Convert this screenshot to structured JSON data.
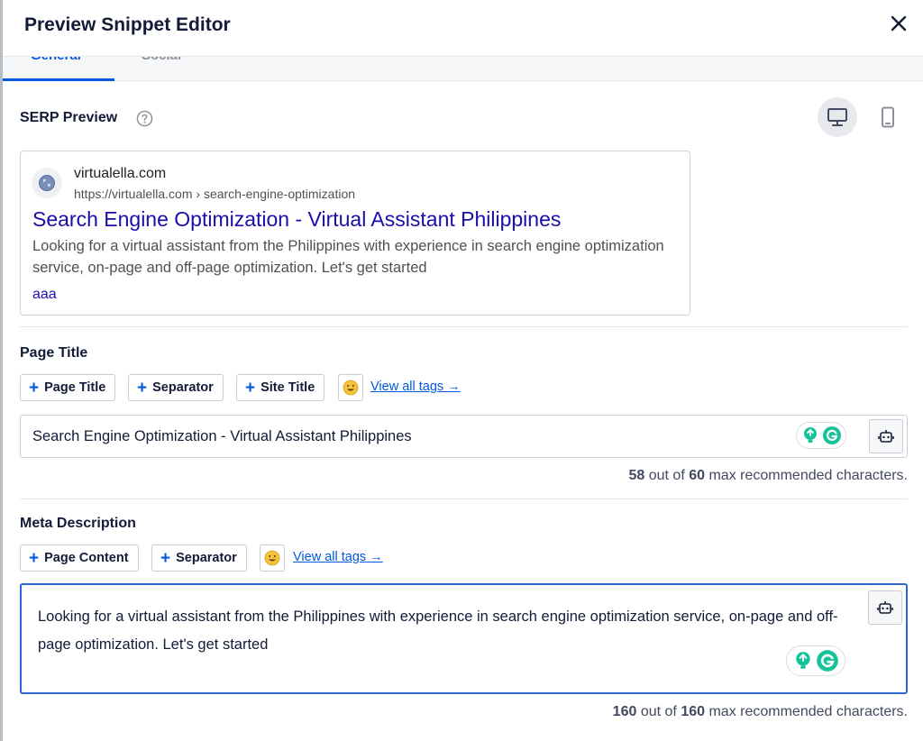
{
  "modal": {
    "title": "Preview Snippet Editor",
    "tabs": [
      {
        "label": "General",
        "active": true
      },
      {
        "label": "Social",
        "active": false
      }
    ]
  },
  "serp": {
    "label": "SERP Preview",
    "help_icon": "question-circle-icon",
    "devices": [
      {
        "name": "desktop",
        "icon": "monitor-icon",
        "active": true
      },
      {
        "name": "mobile",
        "icon": "smartphone-icon",
        "active": false
      }
    ],
    "domain": "virtualella.com",
    "url": "https://virtualella.com › search-engine-optimization",
    "title": "Search Engine Optimization - Virtual Assistant Philippines",
    "description": "Looking for a virtual assistant from the Philippines with experience in search engine optimization service, on-page and off-page optimization. Let's get started",
    "extra_link": "aaa"
  },
  "page_title": {
    "label": "Page Title",
    "tags": [
      "Page Title",
      "Separator",
      "Site Title"
    ],
    "view_all": "View all tags →",
    "value": "Search Engine Optimization - Virtual Assistant Philippines",
    "count": "58",
    "max": "60",
    "counter_prefix": "out of",
    "counter_suffix": "max recommended characters."
  },
  "meta_description": {
    "label": "Meta Description",
    "tags": [
      "Page Content",
      "Separator"
    ],
    "view_all": "View all tags →",
    "value": "Looking for a virtual assistant from the Philippines with experience in search engine optimization service, on-page and off-page optimization. Let's get started",
    "count": "160",
    "max": "160",
    "counter_prefix": "out of",
    "counter_suffix": "max recommended characters."
  },
  "colors": {
    "accent": "#005ae0",
    "serp_title": "#1a0dab",
    "focus_border": "#2c64d0",
    "grammarly_green": "#15c39a"
  }
}
